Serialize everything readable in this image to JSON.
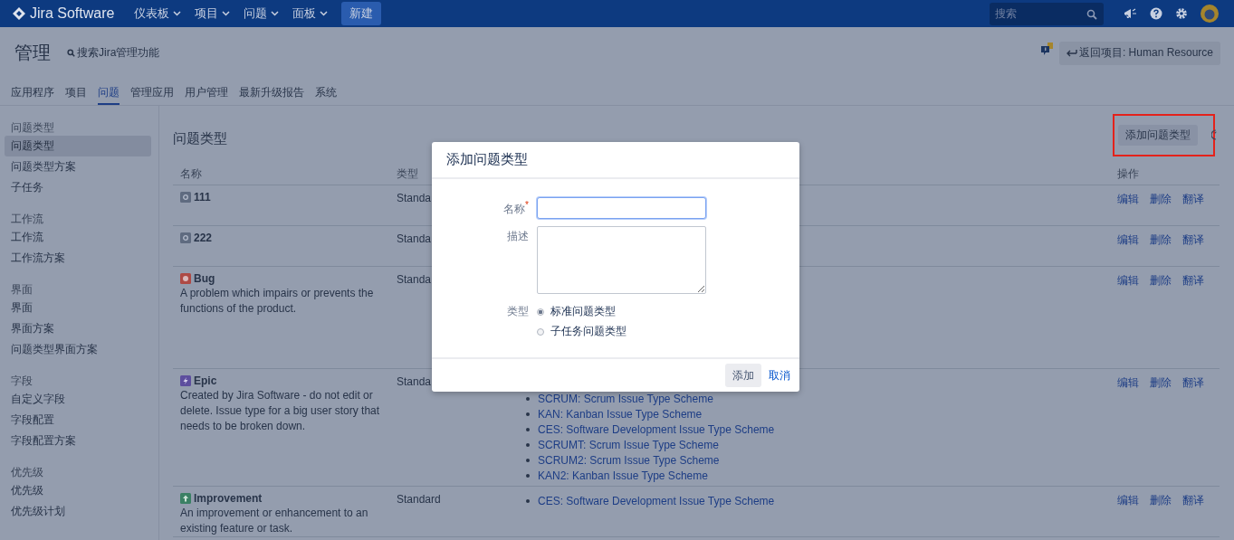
{
  "top_nav": {
    "logo": "Jira Software",
    "menus": [
      {
        "label": "仪表板"
      },
      {
        "label": "项目"
      },
      {
        "label": "问题"
      },
      {
        "label": "面板"
      }
    ],
    "create_button": "新建",
    "search": {
      "placeholder": "搜索"
    }
  },
  "header": {
    "title": "管理",
    "search_link": "搜索Jira管理功能",
    "back_button": "返回项目: Human Resource"
  },
  "tabs": [
    {
      "label": "应用程序",
      "selected": false
    },
    {
      "label": "项目",
      "selected": false
    },
    {
      "label": "问题",
      "selected": true
    },
    {
      "label": "管理应用",
      "selected": false
    },
    {
      "label": "用户管理",
      "selected": false
    },
    {
      "label": "最新升级报告",
      "selected": false
    },
    {
      "label": "系统",
      "selected": false
    }
  ],
  "sidebar": {
    "groups": [
      {
        "heading": "问题类型",
        "items": [
          {
            "label": "问题类型",
            "selected": true
          },
          {
            "label": "问题类型方案",
            "selected": false
          },
          {
            "label": "子任务",
            "selected": false
          }
        ]
      },
      {
        "heading": "工作流",
        "items": [
          {
            "label": "工作流",
            "selected": false
          },
          {
            "label": "工作流方案",
            "selected": false
          }
        ]
      },
      {
        "heading": "界面",
        "items": [
          {
            "label": "界面",
            "selected": false
          },
          {
            "label": "界面方案",
            "selected": false
          },
          {
            "label": "问题类型界面方案",
            "selected": false
          }
        ]
      },
      {
        "heading": "字段",
        "items": [
          {
            "label": "自定义字段",
            "selected": false
          },
          {
            "label": "字段配置",
            "selected": false
          },
          {
            "label": "字段配置方案",
            "selected": false
          }
        ]
      },
      {
        "heading": "优先级",
        "items": [
          {
            "label": "优先级",
            "selected": false
          },
          {
            "label": "优先级计划",
            "selected": false
          }
        ]
      }
    ]
  },
  "page": {
    "title": "问题类型",
    "add_button": {
      "label": "添加问题类型",
      "highlighted": true
    }
  },
  "table": {
    "columns": [
      "名称",
      "类型",
      "操作"
    ],
    "rows": [
      {
        "name": "111",
        "kind": "generic",
        "description": "",
        "type": "Standa",
        "schemes": [],
        "actions": [
          "编辑",
          "删除",
          "翻译"
        ]
      },
      {
        "name": "222",
        "kind": "generic",
        "description": "",
        "type": "Standa",
        "schemes": [],
        "actions": [
          "编辑",
          "删除",
          "翻译"
        ]
      },
      {
        "name": "Bug",
        "kind": "bug",
        "description": "A problem which impairs or prevents the functions of the product.",
        "type": "Standa",
        "schemes": [],
        "actions": [
          "编辑",
          "删除",
          "翻译"
        ]
      },
      {
        "name": "Epic",
        "kind": "epic",
        "description": "Created by Jira Software - do not edit or delete. Issue type for a big user story that needs to be broken down.",
        "type": "Standa",
        "schemes": [
          "SCRUM: Scrum Issue Type Scheme",
          "KAN: Kanban Issue Type Scheme",
          "CES: Software Development Issue Type Scheme",
          "SCRUMT: Scrum Issue Type Scheme",
          "SCRUM2: Scrum Issue Type Scheme",
          "KAN2: Kanban Issue Type Scheme"
        ],
        "actions": [
          "编辑",
          "删除",
          "翻译"
        ]
      },
      {
        "name": "Improvement",
        "kind": "improvement",
        "description": "An improvement or enhancement to an existing feature or task.",
        "type": "Standard",
        "schemes": [
          "CES: Software Development Issue Type Scheme"
        ],
        "actions": [
          "编辑",
          "删除",
          "翻译"
        ]
      }
    ]
  },
  "dialog": {
    "title": "添加问题类型",
    "name_label": "名称",
    "required_mark": "*",
    "description_label": "描述",
    "type_label": "类型",
    "type_options": [
      {
        "label": "标准问题类型",
        "selected": true
      },
      {
        "label": "子任务问题类型",
        "selected": false
      }
    ],
    "add_button": "添加",
    "cancel_link": "取消"
  }
}
